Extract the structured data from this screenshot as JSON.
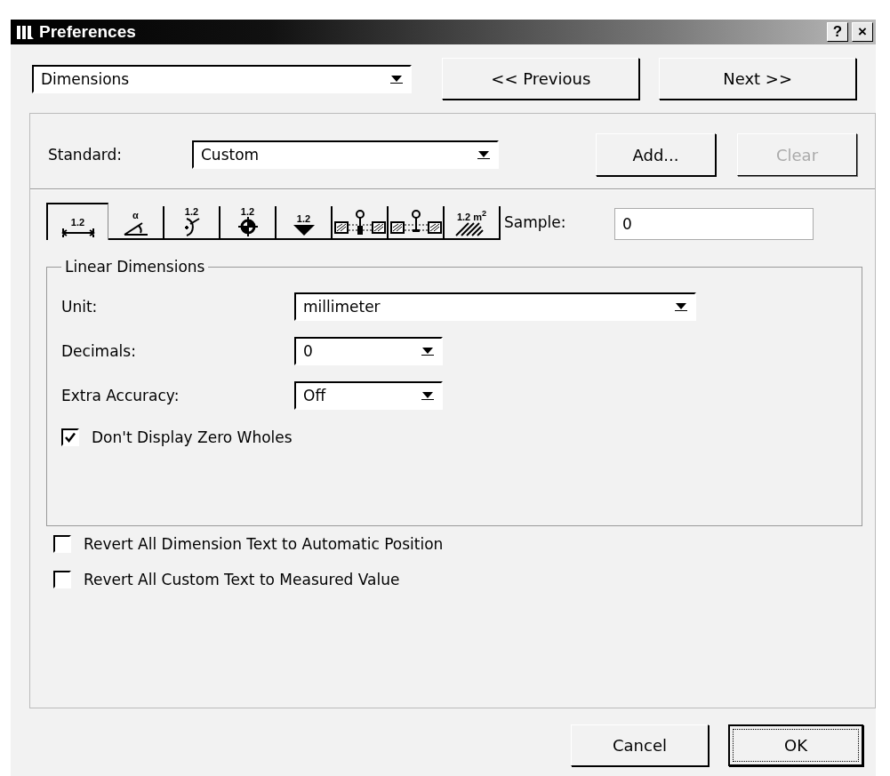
{
  "window": {
    "title": "Preferences",
    "help_button": "?",
    "close_button": "×"
  },
  "page_select": {
    "value": "Dimensions"
  },
  "nav_buttons": [
    "<< Previous",
    "Next >>"
  ],
  "standard": {
    "label": "Standard:",
    "value": "Custom"
  },
  "standard_buttons": [
    {
      "label": "Add...",
      "disabled": false
    },
    {
      "label": "Clear",
      "disabled": true
    }
  ],
  "tabs": [
    {
      "kind": "linear",
      "label": "1.2",
      "selected": true
    },
    {
      "kind": "angle",
      "label": "α",
      "selected": false
    },
    {
      "kind": "radius",
      "label": "1.2",
      "selected": false
    },
    {
      "kind": "level",
      "label": "1.2",
      "selected": false
    },
    {
      "kind": "elevation",
      "label": "1.2",
      "selected": false
    },
    {
      "kind": "sill",
      "selected": false
    },
    {
      "kind": "header",
      "selected": false
    },
    {
      "kind": "area",
      "label": "1.2 m$^{2}$",
      "selected": false
    }
  ],
  "sample": {
    "label": "Sample:",
    "value": "0"
  },
  "group": {
    "title": "Linear Dimensions",
    "fields": [
      {
        "label": "Unit:",
        "value": "millimeter",
        "kind": "wide"
      },
      {
        "label": "Decimals:",
        "value": "0",
        "kind": "narrow"
      },
      {
        "label": "Extra Accuracy:",
        "value": "Off",
        "kind": "narrow"
      }
    ],
    "checkbox": {
      "label": "Don't Display Zero Wholes",
      "checked": true
    }
  },
  "options": [
    {
      "label": "Revert All Dimension Text to Automatic Position",
      "checked": false
    },
    {
      "label": "Revert All Custom Text to Measured Value",
      "checked": false
    }
  ],
  "buttons": [
    {
      "label": "Cancel",
      "default": false
    },
    {
      "label": "OK",
      "default": true
    }
  ]
}
